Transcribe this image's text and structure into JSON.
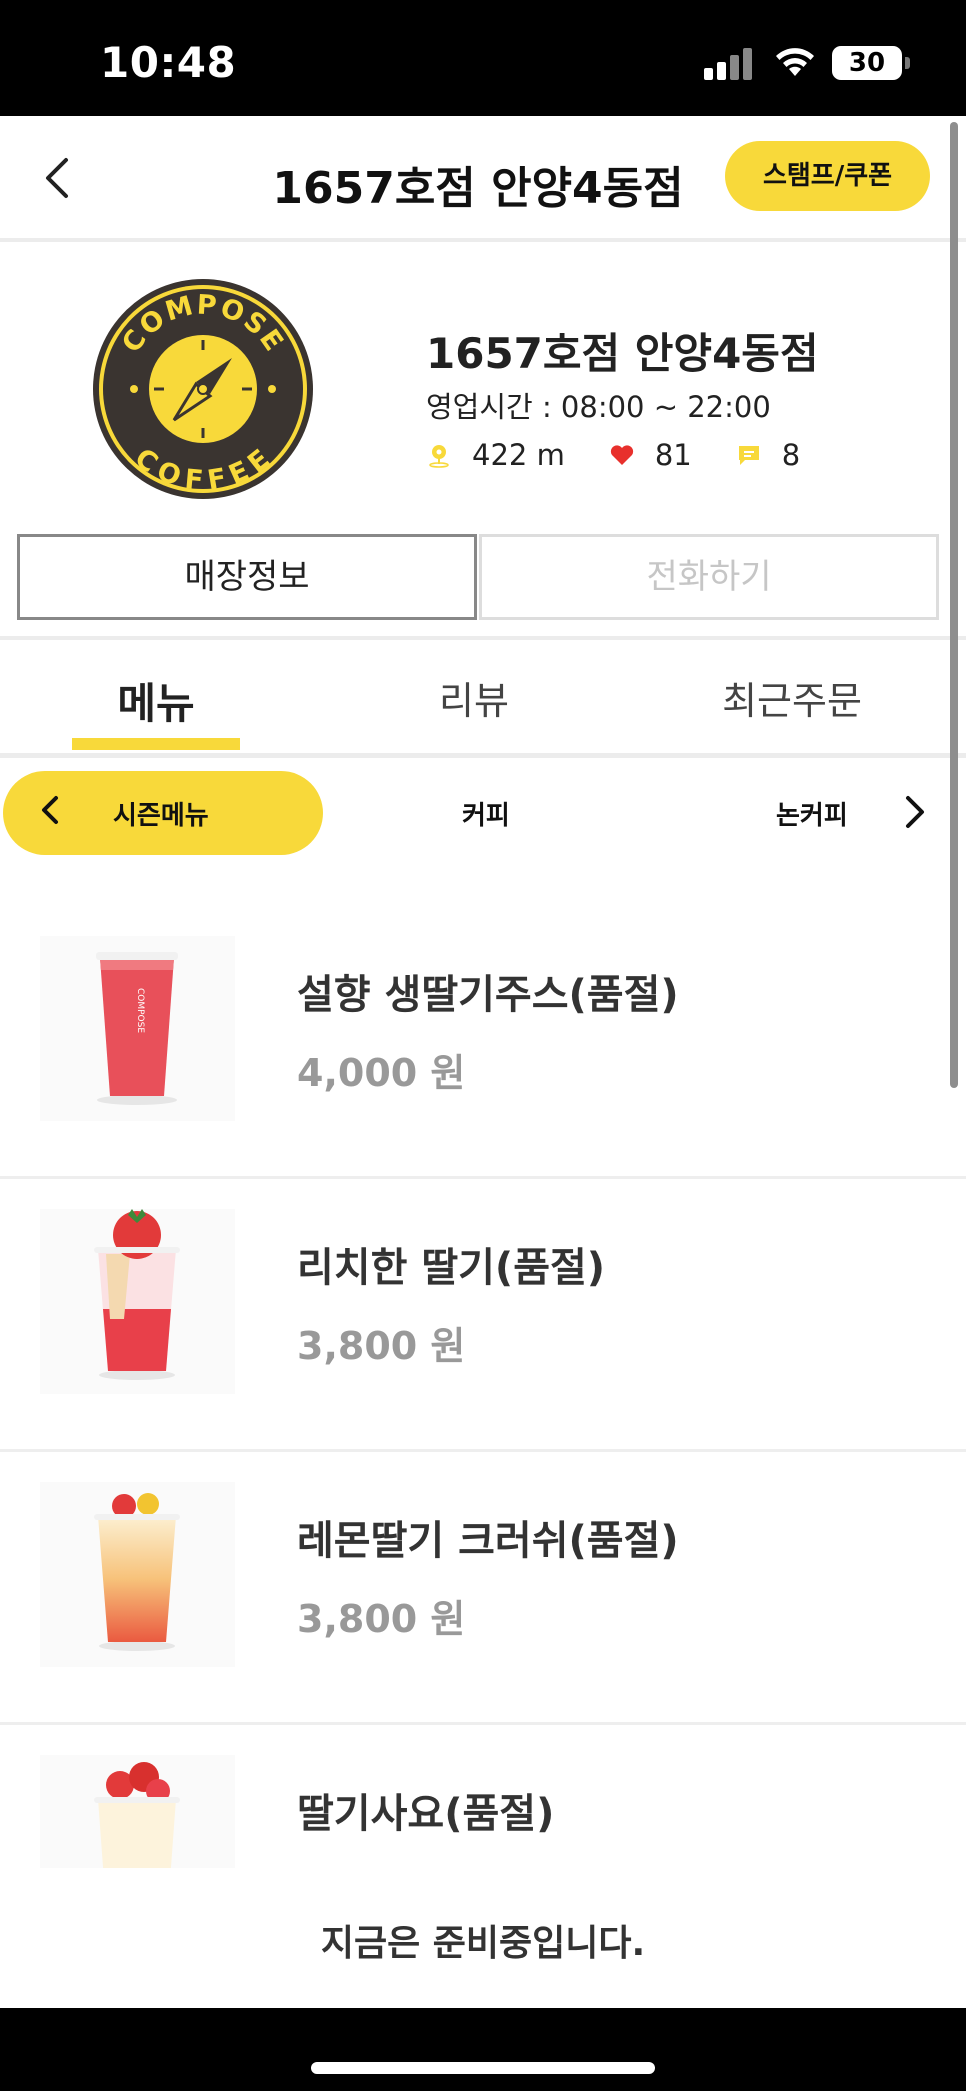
{
  "status_bar": {
    "time": "10:48",
    "battery": "30"
  },
  "header": {
    "title": "1657호점 안양4동점",
    "stamp_button": "스탬프/쿠폰"
  },
  "store": {
    "logo_text_top": "COMPOSE",
    "logo_text_bottom": "COFFEE",
    "name": "1657호점 안양4동점",
    "hours": "영업시간 : 08:00 ~ 22:00",
    "distance": "422 m",
    "likes": "81",
    "reviews": "8",
    "info_button": "매장정보",
    "call_button": "전화하기"
  },
  "tabs": [
    {
      "label": "메뉴",
      "active": true
    },
    {
      "label": "리뷰",
      "active": false
    },
    {
      "label": "최근주문",
      "active": false
    }
  ],
  "categories": [
    {
      "label": "시즌메뉴",
      "active": true
    },
    {
      "label": "커피",
      "active": false
    },
    {
      "label": "논커피",
      "active": false
    }
  ],
  "menu_items": [
    {
      "name": "설향 생딸기주스(품절)",
      "price": "4,000 원",
      "image": "strawberry-juice-cup"
    },
    {
      "name": "리치한 딸기(품절)",
      "price": "3,800 원",
      "image": "rich-strawberry-cup"
    },
    {
      "name": "레몬딸기 크러쉬(품절)",
      "price": "3,800 원",
      "image": "lemon-strawberry-crush-cup"
    },
    {
      "name": "딸기사요(품절)",
      "price": "",
      "image": "strawberry-drink-cup"
    }
  ],
  "footer": {
    "notice": "지금은 준비중입니다."
  },
  "colors": {
    "accent": "#f8d93a",
    "price_gray": "#999999",
    "logo_dark": "#3a3430"
  }
}
